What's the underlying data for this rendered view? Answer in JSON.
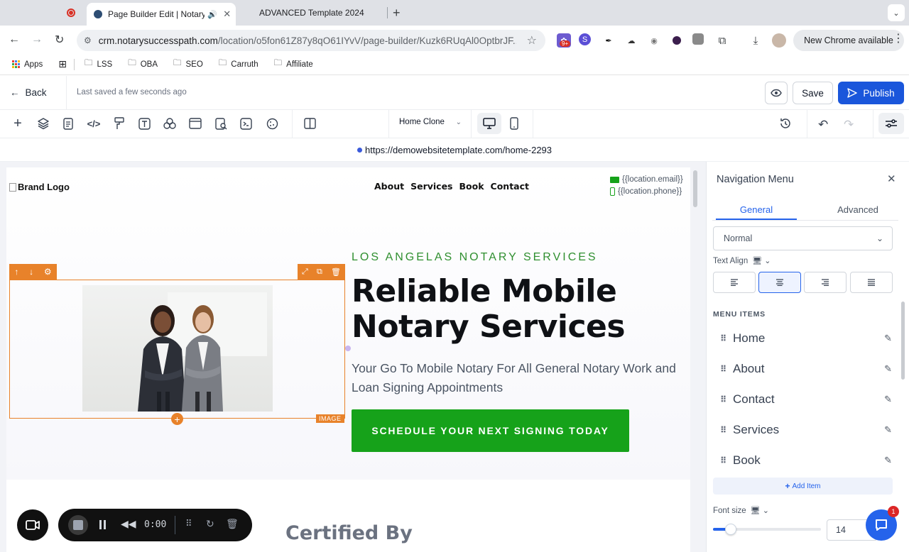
{
  "browser": {
    "tabs": [
      {
        "title": "Page Builder Edit | Notary",
        "active": true
      },
      {
        "title": "ADVANCED Template 2024",
        "active": false
      }
    ],
    "url_domain": "crm.notarysuccesspath.com",
    "url_path": "/location/o5fon61Z87y8qO61IYvV/page-builder/Kuzk6RUqAl0OptbrJF...",
    "ext_badge": "9+",
    "new_chrome_label": "New Chrome available",
    "bookmarks": [
      "Apps",
      "LSS",
      "OBA",
      "SEO",
      "Carruth",
      "Affiliate"
    ]
  },
  "builder": {
    "back_label": "Back",
    "saved_status": "Last saved a few seconds ago",
    "save_label": "Save",
    "publish_label": "Publish",
    "page_select": "Home Clone",
    "preview_url": "https://demowebsitetemplate.com/home-2293"
  },
  "site": {
    "brand_logo_alt": "Brand Logo",
    "nav": [
      "About",
      "Services",
      "Book",
      "Contact"
    ],
    "email": "{{location.email}}",
    "phone": "{{location.phone}}",
    "eyebrow": "LOS ANGELAS NOTARY SERVICES",
    "headline_line1": "Reliable Mobile",
    "headline_line2": "Notary Services",
    "subtext": "Your Go To Mobile Notary For All General Notary Work and Loan Signing Appointments",
    "cta": "SCHEDULE YOUR NEXT SIGNING TODAY",
    "image_tag": "IMAGE",
    "next_section_heading": "Certified By"
  },
  "panel": {
    "title": "Navigation Menu",
    "tabs": [
      "General",
      "Advanced"
    ],
    "active_tab": "General",
    "style_select": "Normal",
    "text_align_label": "Text Align",
    "menu_items_label": "MENU ITEMS",
    "menu_items": [
      "Home",
      "About",
      "Contact",
      "Services",
      "Book"
    ],
    "add_item_label": "Add Item",
    "font_size_label": "Font size",
    "font_size_value": "14",
    "chat_badge": "1"
  },
  "recorder": {
    "time": "0:00"
  },
  "colors": {
    "publish_blue": "#1a56db",
    "accent_orange": "#e8822a",
    "brand_green": "#16a21a",
    "eyebrow_green": "#2f8f2f",
    "panel_blue": "#2563eb"
  }
}
